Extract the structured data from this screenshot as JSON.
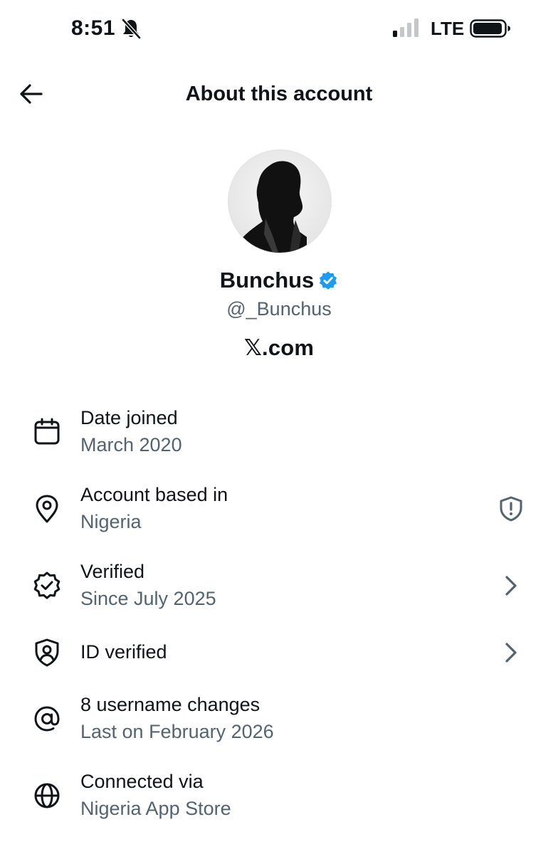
{
  "status_bar": {
    "time": "8:51",
    "network": "LTE",
    "icons": [
      "bell-slash-icon",
      "signal-icon",
      "battery-icon"
    ]
  },
  "header": {
    "title": "About this account",
    "back_icon": "arrow-left-icon"
  },
  "profile": {
    "display_name": "Bunchus",
    "handle": "@_Bunchus",
    "verified": true,
    "site_symbol": "𝕏",
    "site_suffix": ".com"
  },
  "details": [
    {
      "icon": "calendar-icon",
      "title": "Date joined",
      "subtitle": "March 2020"
    },
    {
      "icon": "location-pin-icon",
      "title": "Account based in",
      "subtitle": "Nigeria",
      "trailing_icon": "shield-alert-icon"
    },
    {
      "icon": "verified-check-icon",
      "title": "Verified",
      "subtitle": "Since July 2025",
      "trailing_icon": "chevron-right-icon"
    },
    {
      "icon": "id-shield-icon",
      "title": "ID verified",
      "trailing_icon": "chevron-right-icon"
    },
    {
      "icon": "at-sign-icon",
      "title": "8 username changes",
      "subtitle": "Last on February 2026"
    },
    {
      "icon": "globe-icon",
      "title": "Connected via",
      "subtitle": "Nigeria App Store"
    }
  ],
  "colors": {
    "text_primary": "#0f1419",
    "text_secondary": "#536471",
    "verified_blue": "#1d9bf0",
    "background": "#ffffff"
  }
}
